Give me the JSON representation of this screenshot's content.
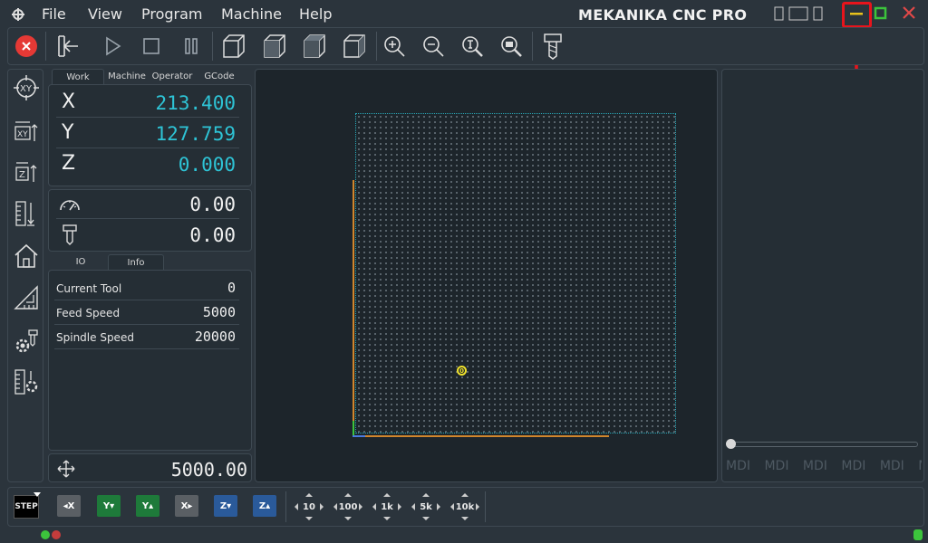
{
  "menu": {
    "file": "File",
    "view": "View",
    "program": "Program",
    "machine": "Machine",
    "help": "Help"
  },
  "app_title": "MEKANIKA CNC PRO",
  "colors": {
    "accent_cyan": "#2ec4d6",
    "highlight_red": "#e8141c",
    "minimize_yellow": "#e8c21c",
    "maximize_green": "#3cc43c",
    "close_red": "#e04848"
  },
  "toolbar_icons": [
    "stop-icon",
    "exit-icon",
    "play-icon",
    "stop-square-icon",
    "pause-icon",
    "cube-view-1-icon",
    "cube-view-2-icon",
    "cube-view-3-icon",
    "cube-view-4-icon",
    "zoom-in-icon",
    "zoom-out-icon",
    "zoom-fit-icon",
    "zoom-selection-icon",
    "tool-icon"
  ],
  "dro_tabs": [
    "Work",
    "Machine",
    "Operator",
    "GCode"
  ],
  "dro": {
    "x": {
      "axis": "X",
      "value": "213.400"
    },
    "y": {
      "axis": "Y",
      "value": "127.759"
    },
    "z": {
      "axis": "Z",
      "value": "0.000"
    }
  },
  "feed_speed_value": "0.00",
  "spindle_value": "0.00",
  "info_tabs": [
    "IO",
    "Info"
  ],
  "info_rows": [
    {
      "label": "Current Tool",
      "value": "0"
    },
    {
      "label": "Feed Speed",
      "value": "5000"
    },
    {
      "label": "Spindle Speed",
      "value": "20000"
    }
  ],
  "jog_feed_value": "5000.00",
  "mdi_labels": [
    "MDI",
    "MDI",
    "MDI",
    "MDI",
    "MDI",
    "M"
  ],
  "step_label": "STEP",
  "jog_buttons": [
    {
      "label": "X",
      "color": "#5a5f64"
    },
    {
      "label": "Y",
      "color": "#1e7a3a"
    },
    {
      "label": "Y",
      "color": "#1e7a3a"
    },
    {
      "label": "X",
      "color": "#5a5f64"
    },
    {
      "label": "Z",
      "color": "#2a5a9a"
    },
    {
      "label": "Z",
      "color": "#2a5a9a"
    }
  ],
  "step_sizes": [
    "10",
    "100",
    "1k",
    "5k",
    "10k"
  ],
  "origin_marker": "0"
}
